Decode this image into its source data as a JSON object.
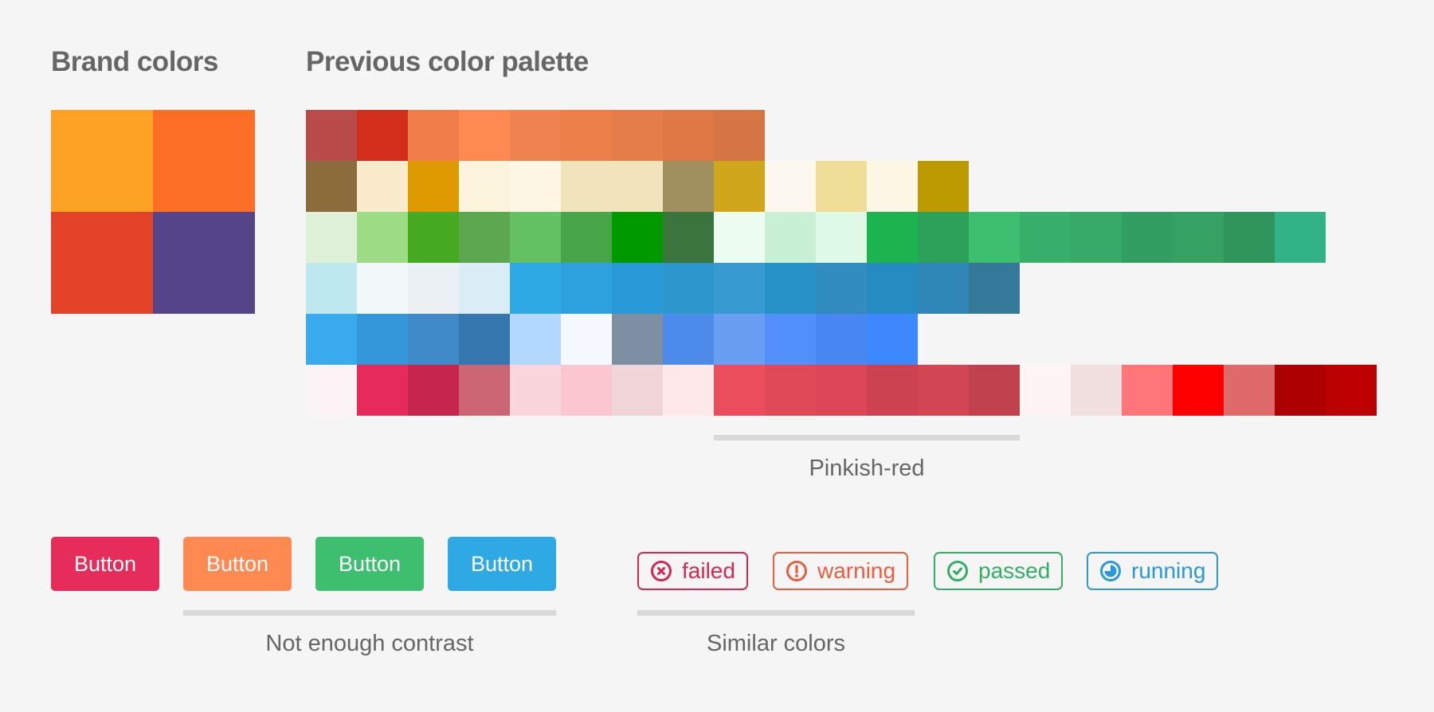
{
  "brand": {
    "title": "Brand colors",
    "colors": [
      "#fca326",
      "#fc6d26",
      "#e24329",
      "#554488"
    ]
  },
  "palette": {
    "title": "Previous color palette",
    "rows": [
      [
        "#b94b4b",
        "#d22e1b",
        "#f07e4a",
        "#fe8a52",
        "#ef834f",
        "#ed7f4a",
        "#e47d4a",
        "#de7845",
        "#d77645"
      ],
      [
        "#8b6d3c",
        "#faebcc",
        "#de9a00",
        "#fbf3dc",
        "#fef7e4",
        "#f1e3ba",
        "#f1e3ba",
        "#a08f5f",
        "#d0a61b",
        "#fcf8f0",
        "#efde98",
        "#fcf7e4",
        "#bd9b00"
      ],
      [
        "#dff0d8",
        "#9ddc84",
        "#45a922",
        "#5ca750",
        "#63c162",
        "#48a448",
        "#009900",
        "#3b753d",
        "#edfcf0",
        "#c7f0d4",
        "#dffbe8",
        "#1db34f",
        "#2ba15a",
        "#3ebe6f",
        "#37ae69",
        "#37aa67",
        "#339e62",
        "#35a162",
        "#30955a",
        "#31b287"
      ],
      [
        "#bde8f0",
        "#f3f8fb",
        "#ebf0f4",
        "#daedf6",
        "#2ea9e4",
        "#2da1de",
        "#2a9ad6",
        "#2d97cd",
        "#379ad0",
        "#2792c8",
        "#318dbd",
        "#268bc1",
        "#2e87b7",
        "#34789a"
      ],
      [
        "#3aaaef",
        "#3497da",
        "#418ac8",
        "#3677b0",
        "#b3d8fe",
        "#f5f9ff",
        "#7f8fa3",
        "#4c8bea",
        "#6a9ef3",
        "#518ffb",
        "#4687f1",
        "#3d88fd"
      ],
      [
        "#fbf3f5",
        "#e62a5a",
        "#c6264b",
        "#cc6674",
        "#fad6dc",
        "#fbc6d0",
        "#f0d5d8",
        "#fde9ea",
        "#eb4d5d",
        "#de4a58",
        "#db4757",
        "#cc4251",
        "#d24654",
        "#c1414e",
        "#fdf5f5",
        "#f2dfe0",
        "#fe7679",
        "#fe0000",
        "#de6a69",
        "#ad0000",
        "#bc0000"
      ]
    ],
    "pinkish_red_caption": "Pinkish-red"
  },
  "buttons": {
    "items": [
      {
        "label": "Button",
        "color": "#e52c5a"
      },
      {
        "label": "Button",
        "color": "#fe8a52"
      },
      {
        "label": "Button",
        "color": "#3ebe6f"
      },
      {
        "label": "Button",
        "color": "#2ea9e4"
      }
    ],
    "caption": "Not enough contrast"
  },
  "badges": {
    "items": [
      {
        "label": "failed",
        "icon": "x-circle-icon",
        "color": "#d22852"
      },
      {
        "label": "warning",
        "icon": "exclamation-circle-icon",
        "color": "#e75e40"
      },
      {
        "label": "passed",
        "icon": "check-circle-icon",
        "color": "#31af64"
      },
      {
        "label": "running",
        "icon": "running-circle-icon",
        "color": "#2a9ad6"
      }
    ],
    "caption": "Similar colors"
  }
}
